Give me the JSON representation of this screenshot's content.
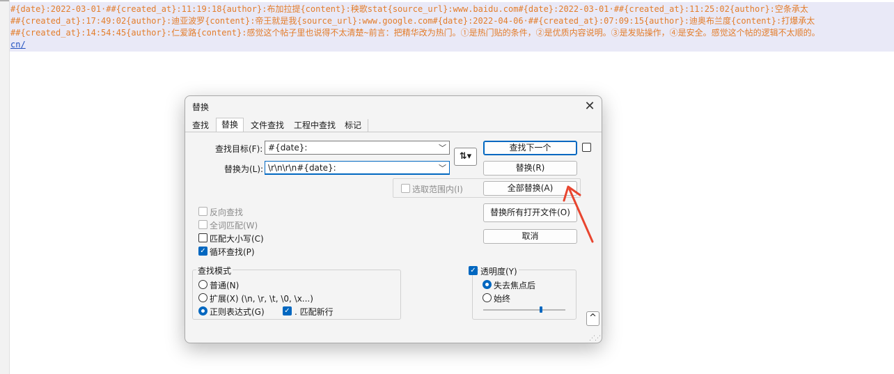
{
  "editor": {
    "lines": [
      "#{date}:2022-03-01·##{created_at}:11:19:18{author}:布加拉提{content}:秧歌stat{source_url}:www.baidu.com#{date}:2022-03-01·##{created_at}:11:25:02{author}:空条承太",
      "##{created_at}:17:49:02{author}:迪亚波罗{content}:帝王就是我{source_url}:www.google.com#{date}:2022-04-06·##{created_at}:07:09:15{author}:迪奥布兰度{content}:打爆承太",
      "##{created_at}:14:54:45{author}:仁爱路{content}:感觉这个帖子里也说得不太清楚~前言：把精华改为热门。①是热门贴的条件，②是优质内容说明。③是发贴操作，④是安全。感觉这个帖的逻辑不太顺的。",
      "cn/"
    ]
  },
  "dialog": {
    "title": "替换",
    "tabs": [
      "查找",
      "替换",
      "文件查找",
      "工程中查找",
      "标记"
    ],
    "find_label": "查找目标(F):",
    "find_value": "#{date}:",
    "replace_label": "替换为(L):",
    "replace_value": "\\r\\n\\r\\n#{date}:",
    "swap_symbol": "⇅▾",
    "buttons": {
      "find_next": "查找下一个",
      "replace": "替换(R)",
      "replace_all": "全部替换(A)",
      "replace_all_open": "替换所有打开文件(O)",
      "cancel": "取消"
    },
    "in_selection": "选取范围内(I)",
    "options": {
      "backward": "反向查找",
      "whole_word": "全词匹配(W)",
      "match_case": "匹配大小写(C)",
      "wrap": "循环查找(P)"
    },
    "search_mode": {
      "title": "查找模式",
      "normal": "普通(N)",
      "extended": "扩展(X) (\\n, \\r, \\t, \\0, \\x...)",
      "regex": "正则表达式(G)",
      "dot_newline": ". 匹配新行"
    },
    "transparency": {
      "label": "透明度(Y)",
      "on_lose_focus": "失去焦点后",
      "always": "始终",
      "level": 0.7
    },
    "collapse_symbol": "^"
  }
}
